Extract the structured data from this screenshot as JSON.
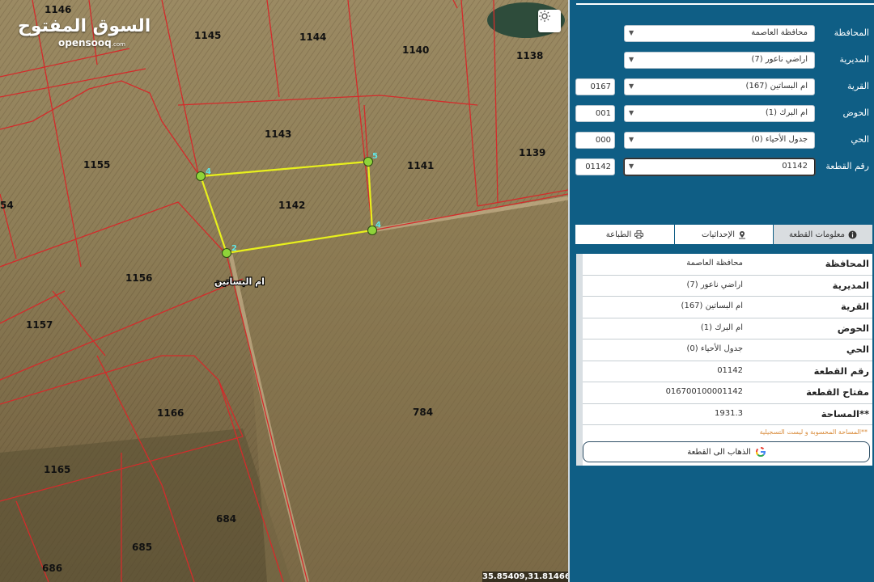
{
  "brand": {
    "name_ar": "السوق المفتوح",
    "name_en": "opensooq",
    "domain": ".com"
  },
  "map": {
    "parcels": [
      "1146",
      "1145",
      "1144",
      "1140",
      "1138",
      "1143",
      "1155",
      "1141",
      "1139",
      "1142",
      "54",
      "1156",
      "1157",
      "1166",
      "784",
      "1165",
      "684",
      "685",
      "686"
    ],
    "selected_parcel": "1142",
    "vertex_labels": [
      "4",
      "5",
      "4",
      "2"
    ],
    "village_label": "ام البساتين",
    "coordinates": "35.85409,31.81466",
    "light_toggle_icon": "sun-icon"
  },
  "form": {
    "fields": [
      {
        "label": "المحافظة",
        "value": "محافظة العاصمة",
        "code": ""
      },
      {
        "label": "المديرية",
        "value": "اراضي ناعور (7)",
        "code": ""
      },
      {
        "label": "القرية",
        "value": "ام البساتين (167)",
        "code": "0167"
      },
      {
        "label": "الحوض",
        "value": "ام البرك (1)",
        "code": "001"
      },
      {
        "label": "الحي",
        "value": "جدول الأحياء (0)",
        "code": "000"
      },
      {
        "label": "رقم القطعة",
        "value": "01142",
        "code": "01142"
      }
    ]
  },
  "tabs": [
    {
      "label": "معلومات القطعة",
      "icon": "info-icon",
      "active": true
    },
    {
      "label": "الإحداثيات",
      "icon": "pin-icon",
      "active": false
    },
    {
      "label": "الطباعة",
      "icon": "printer-icon",
      "active": false
    }
  ],
  "info": {
    "rows": [
      {
        "key": "المحافظة",
        "value": "محافظة العاصمة"
      },
      {
        "key": "المديرية",
        "value": "اراضي ناعور (7)"
      },
      {
        "key": "القرية",
        "value": "ام البساتين (167)"
      },
      {
        "key": "الحوض",
        "value": "ام البرك (1)"
      },
      {
        "key": "الحي",
        "value": "جدول الأحياء (0)"
      },
      {
        "key": "رقم القطعة",
        "value": "01142"
      },
      {
        "key": "مفتاح القطعة",
        "value": "016700100001142"
      },
      {
        "key": "**المساحة",
        "value": "1931.3"
      }
    ],
    "note": "**المساحة المحسوبة و ليست التسجيلية",
    "goto_label": "الذهاب الى القطعة"
  },
  "colors": {
    "panel_bg": "#0f5e85",
    "parcel_line": "#d42b2b",
    "selection_line": "#e8f01c",
    "vertex_fill": "#8fd43a",
    "note_text": "#d98b3a"
  }
}
